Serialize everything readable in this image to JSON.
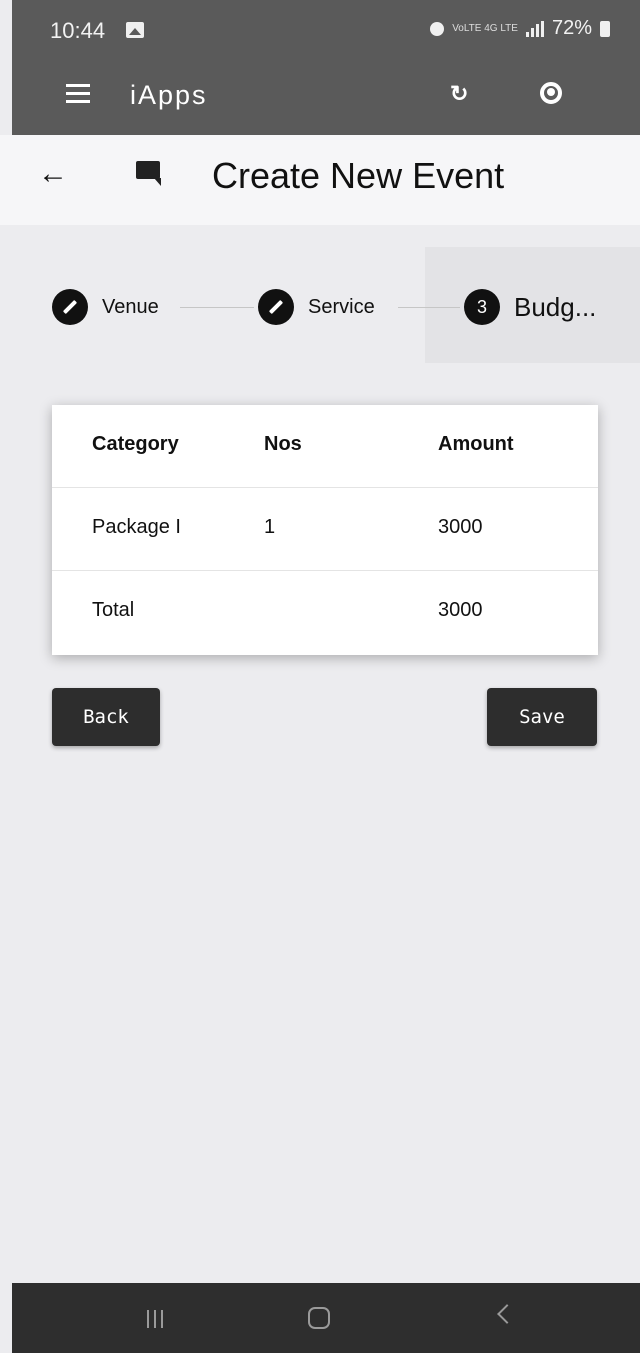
{
  "status_bar": {
    "time": "10:44",
    "network": "VoLTE 4G LTE",
    "battery": "72%"
  },
  "app_bar": {
    "title": "iApps",
    "icons": [
      "menu-icon",
      "refresh-icon",
      "account-icon"
    ]
  },
  "header": {
    "title": "Create New Event",
    "icons": [
      "back-arrow-icon",
      "chat-icon"
    ]
  },
  "stepper": {
    "steps": [
      {
        "label": "Venue",
        "state": "edit"
      },
      {
        "label": "Service",
        "state": "edit"
      },
      {
        "number": "3",
        "label": "Budg...",
        "state": "active"
      }
    ]
  },
  "budget_table": {
    "columns": [
      "Category",
      "Nos",
      "Amount"
    ],
    "rows": [
      {
        "category": "Package I",
        "nos": "1",
        "amount": "3000"
      }
    ],
    "total": {
      "label": "Total",
      "amount": "3000"
    }
  },
  "actions": {
    "back_label": "Back",
    "save_label": "Save"
  },
  "colors": {
    "app_bar": "#5a5a5a",
    "button": "#2d2d2d",
    "background": "#ececef",
    "nav_bar": "#2e2e2e"
  }
}
